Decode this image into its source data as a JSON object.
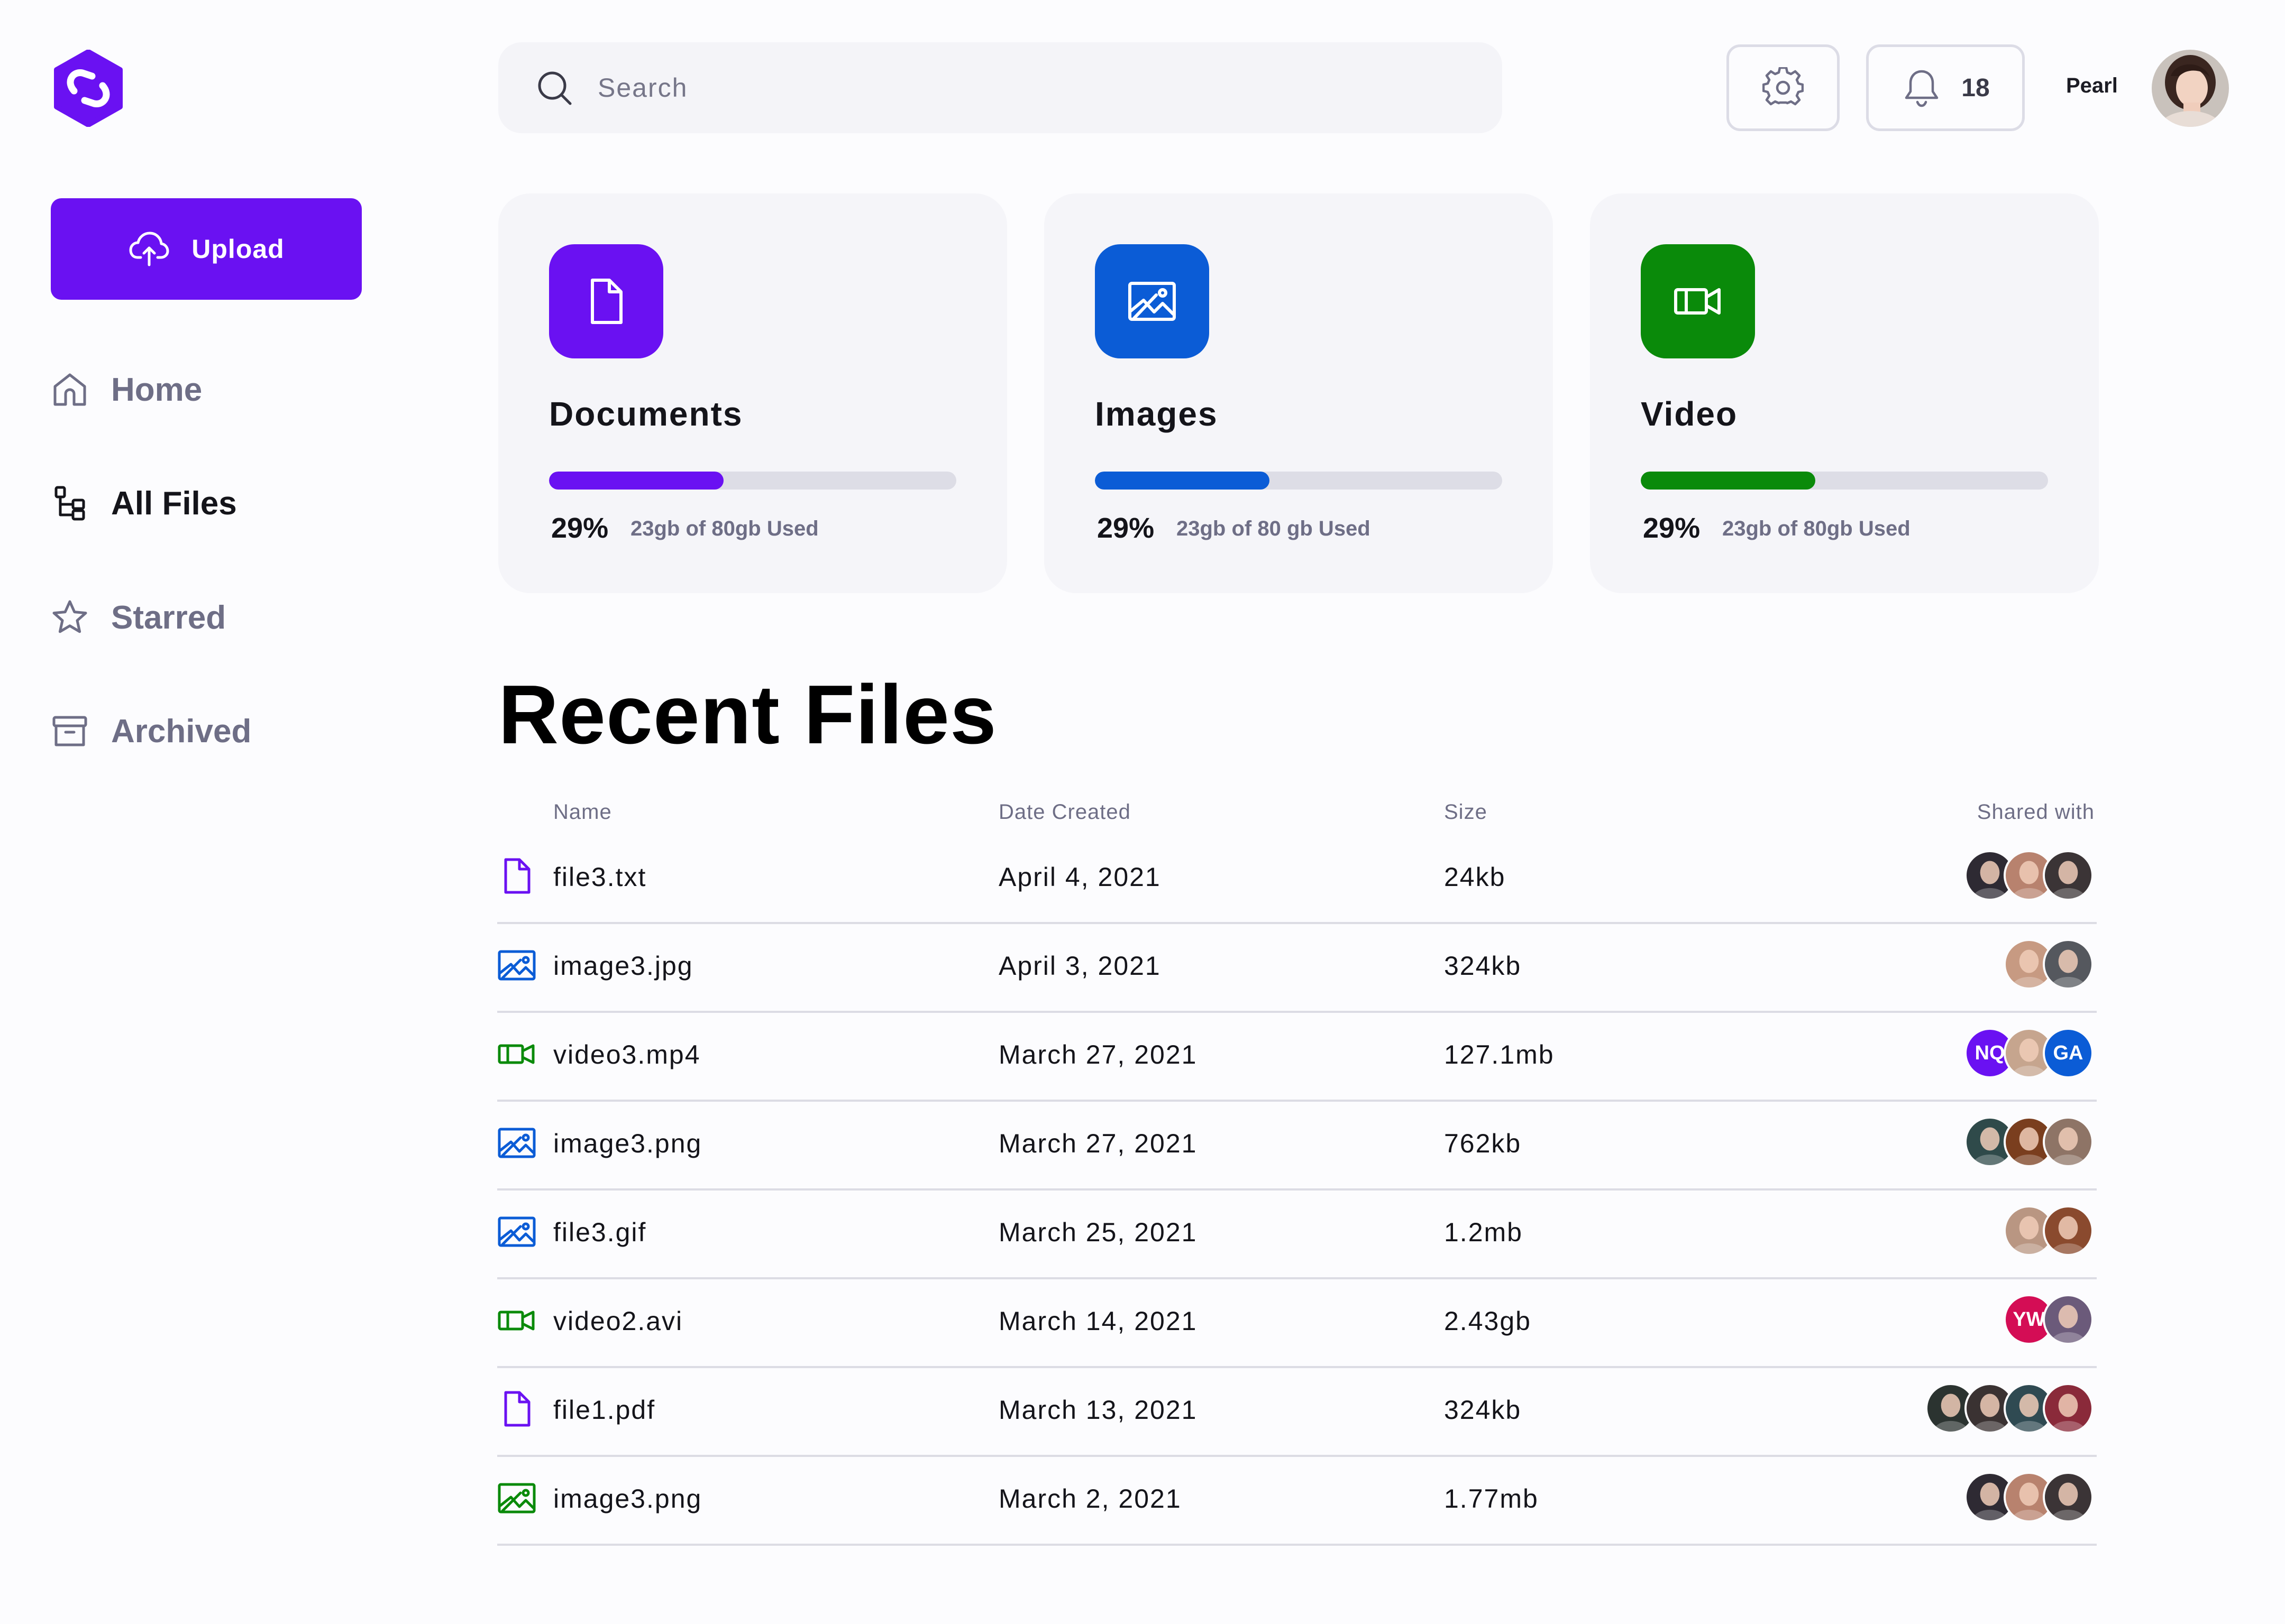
{
  "brand": {
    "logo_icon": "brand-logo-icon",
    "accent": "#6A11F2"
  },
  "sidebar": {
    "upload_label": "Upload",
    "items": [
      {
        "label": "Home",
        "icon": "home-icon",
        "active": false
      },
      {
        "label": "All Files",
        "icon": "files-tree-icon",
        "active": true
      },
      {
        "label": "Starred",
        "icon": "star-icon",
        "active": false
      },
      {
        "label": "Archived",
        "icon": "archive-icon",
        "active": false
      }
    ]
  },
  "header": {
    "search_placeholder": "Search",
    "notifications_count": "18",
    "user_name": "Pearl"
  },
  "categories": [
    {
      "title": "Documents",
      "percent_label": "29%",
      "progress": 0.29,
      "used": "23gb of 80gb Used",
      "color": "#6A11F2",
      "icon": "document-icon"
    },
    {
      "title": "Images",
      "percent_label": "29%",
      "progress": 0.29,
      "used": "23gb of 80 gb Used",
      "color": "#0B5CD6",
      "icon": "image-icon"
    },
    {
      "title": "Video",
      "percent_label": "29%",
      "progress": 0.29,
      "used": "23gb of 80gb Used",
      "color": "#0A8A0A",
      "icon": "video-icon"
    }
  ],
  "recent": {
    "title": "Recent Files",
    "columns": {
      "name": "Name",
      "date": "Date Created",
      "size": "Size",
      "shared": "Shared with"
    },
    "rows": [
      {
        "name": "file3.txt",
        "date": "April 4, 2021",
        "size": "24kb",
        "type": "document",
        "color": "#6A11F2",
        "shared": [
          {
            "initials": "",
            "bg": "#2E2A33"
          },
          {
            "initials": "",
            "bg": "#B8826E"
          },
          {
            "initials": "",
            "bg": "#3B3436"
          }
        ]
      },
      {
        "name": "image3.jpg",
        "date": "April 3, 2021",
        "size": "324kb",
        "type": "image",
        "color": "#0B5CD6",
        "shared": [
          {
            "initials": "",
            "bg": "#C79A82"
          },
          {
            "initials": "",
            "bg": "#55585E"
          }
        ]
      },
      {
        "name": "video3.mp4",
        "date": "March 27, 2021",
        "size": "127.1mb",
        "type": "video",
        "color": "#0A8A0A",
        "shared": [
          {
            "initials": "NQ",
            "bg": "#6A11F2"
          },
          {
            "initials": "",
            "bg": "#C6A58E"
          },
          {
            "initials": "GA",
            "bg": "#0B5CD6"
          }
        ]
      },
      {
        "name": "image3.png",
        "date": "March 27, 2021",
        "size": "762kb",
        "type": "image",
        "color": "#0B5CD6",
        "shared": [
          {
            "initials": "",
            "bg": "#2F4A4A"
          },
          {
            "initials": "",
            "bg": "#7A3E1E"
          },
          {
            "initials": "",
            "bg": "#8E7466"
          }
        ]
      },
      {
        "name": "file3.gif",
        "date": "March 25, 2021",
        "size": "1.2mb",
        "type": "image",
        "color": "#0B5CD6",
        "shared": [
          {
            "initials": "",
            "bg": "#B99682"
          },
          {
            "initials": "",
            "bg": "#8A4A2E"
          }
        ]
      },
      {
        "name": "video2.avi",
        "date": "March 14, 2021",
        "size": "2.43gb",
        "type": "video",
        "color": "#0A8A0A",
        "shared": [
          {
            "initials": "YW",
            "bg": "#D40D55"
          },
          {
            "initials": "",
            "bg": "#6B5A7A"
          }
        ]
      },
      {
        "name": "file1.pdf",
        "date": "March 13, 2021",
        "size": "324kb",
        "type": "document",
        "color": "#6A11F2",
        "shared": [
          {
            "initials": "",
            "bg": "#2B3330"
          },
          {
            "initials": "",
            "bg": "#3A3232"
          },
          {
            "initials": "",
            "bg": "#2F4A52"
          },
          {
            "initials": "",
            "bg": "#8A2A3A"
          }
        ]
      },
      {
        "name": "image3.png",
        "date": "March 2, 2021",
        "size": "1.77mb",
        "type": "image",
        "color": "#0A8A0A",
        "shared": [
          {
            "initials": "",
            "bg": "#2E2A33"
          },
          {
            "initials": "",
            "bg": "#B8826E"
          },
          {
            "initials": "",
            "bg": "#3B3436"
          }
        ]
      }
    ]
  }
}
